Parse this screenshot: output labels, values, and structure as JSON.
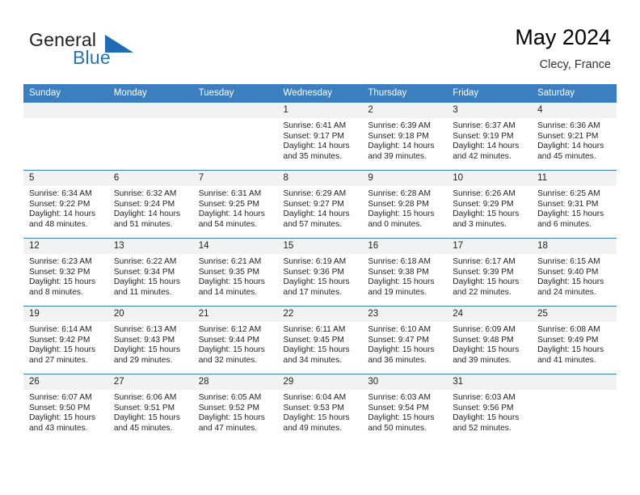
{
  "brand": {
    "name_part1": "General",
    "name_part2": "Blue",
    "triangle_color": "#1f6cb4"
  },
  "header": {
    "title": "May 2024",
    "subtitle": "Clecy, France"
  },
  "theme": {
    "header_blue": "#3c7fc1",
    "daynum_bg": "#f2f2f2",
    "text": "#231f20"
  },
  "weekday_headers": [
    "Sunday",
    "Monday",
    "Tuesday",
    "Wednesday",
    "Thursday",
    "Friday",
    "Saturday"
  ],
  "labels": {
    "sunrise_prefix": "Sunrise: ",
    "sunset_prefix": "Sunset: ",
    "daylight_prefix": "Daylight: "
  },
  "weeks": [
    [
      {
        "day": "",
        "empty": true
      },
      {
        "day": "",
        "empty": true
      },
      {
        "day": "",
        "empty": true
      },
      {
        "day": "1",
        "sunrise": "Sunrise: 6:41 AM",
        "sunset": "Sunset: 9:17 PM",
        "daylight_line1": "Daylight: 14 hours",
        "daylight_line2": "and 35 minutes."
      },
      {
        "day": "2",
        "sunrise": "Sunrise: 6:39 AM",
        "sunset": "Sunset: 9:18 PM",
        "daylight_line1": "Daylight: 14 hours",
        "daylight_line2": "and 39 minutes."
      },
      {
        "day": "3",
        "sunrise": "Sunrise: 6:37 AM",
        "sunset": "Sunset: 9:19 PM",
        "daylight_line1": "Daylight: 14 hours",
        "daylight_line2": "and 42 minutes."
      },
      {
        "day": "4",
        "sunrise": "Sunrise: 6:36 AM",
        "sunset": "Sunset: 9:21 PM",
        "daylight_line1": "Daylight: 14 hours",
        "daylight_line2": "and 45 minutes."
      }
    ],
    [
      {
        "day": "5",
        "sunrise": "Sunrise: 6:34 AM",
        "sunset": "Sunset: 9:22 PM",
        "daylight_line1": "Daylight: 14 hours",
        "daylight_line2": "and 48 minutes."
      },
      {
        "day": "6",
        "sunrise": "Sunrise: 6:32 AM",
        "sunset": "Sunset: 9:24 PM",
        "daylight_line1": "Daylight: 14 hours",
        "daylight_line2": "and 51 minutes."
      },
      {
        "day": "7",
        "sunrise": "Sunrise: 6:31 AM",
        "sunset": "Sunset: 9:25 PM",
        "daylight_line1": "Daylight: 14 hours",
        "daylight_line2": "and 54 minutes."
      },
      {
        "day": "8",
        "sunrise": "Sunrise: 6:29 AM",
        "sunset": "Sunset: 9:27 PM",
        "daylight_line1": "Daylight: 14 hours",
        "daylight_line2": "and 57 minutes."
      },
      {
        "day": "9",
        "sunrise": "Sunrise: 6:28 AM",
        "sunset": "Sunset: 9:28 PM",
        "daylight_line1": "Daylight: 15 hours",
        "daylight_line2": "and 0 minutes."
      },
      {
        "day": "10",
        "sunrise": "Sunrise: 6:26 AM",
        "sunset": "Sunset: 9:29 PM",
        "daylight_line1": "Daylight: 15 hours",
        "daylight_line2": "and 3 minutes."
      },
      {
        "day": "11",
        "sunrise": "Sunrise: 6:25 AM",
        "sunset": "Sunset: 9:31 PM",
        "daylight_line1": "Daylight: 15 hours",
        "daylight_line2": "and 6 minutes."
      }
    ],
    [
      {
        "day": "12",
        "sunrise": "Sunrise: 6:23 AM",
        "sunset": "Sunset: 9:32 PM",
        "daylight_line1": "Daylight: 15 hours",
        "daylight_line2": "and 8 minutes."
      },
      {
        "day": "13",
        "sunrise": "Sunrise: 6:22 AM",
        "sunset": "Sunset: 9:34 PM",
        "daylight_line1": "Daylight: 15 hours",
        "daylight_line2": "and 11 minutes."
      },
      {
        "day": "14",
        "sunrise": "Sunrise: 6:21 AM",
        "sunset": "Sunset: 9:35 PM",
        "daylight_line1": "Daylight: 15 hours",
        "daylight_line2": "and 14 minutes."
      },
      {
        "day": "15",
        "sunrise": "Sunrise: 6:19 AM",
        "sunset": "Sunset: 9:36 PM",
        "daylight_line1": "Daylight: 15 hours",
        "daylight_line2": "and 17 minutes."
      },
      {
        "day": "16",
        "sunrise": "Sunrise: 6:18 AM",
        "sunset": "Sunset: 9:38 PM",
        "daylight_line1": "Daylight: 15 hours",
        "daylight_line2": "and 19 minutes."
      },
      {
        "day": "17",
        "sunrise": "Sunrise: 6:17 AM",
        "sunset": "Sunset: 9:39 PM",
        "daylight_line1": "Daylight: 15 hours",
        "daylight_line2": "and 22 minutes."
      },
      {
        "day": "18",
        "sunrise": "Sunrise: 6:15 AM",
        "sunset": "Sunset: 9:40 PM",
        "daylight_line1": "Daylight: 15 hours",
        "daylight_line2": "and 24 minutes."
      }
    ],
    [
      {
        "day": "19",
        "sunrise": "Sunrise: 6:14 AM",
        "sunset": "Sunset: 9:42 PM",
        "daylight_line1": "Daylight: 15 hours",
        "daylight_line2": "and 27 minutes."
      },
      {
        "day": "20",
        "sunrise": "Sunrise: 6:13 AM",
        "sunset": "Sunset: 9:43 PM",
        "daylight_line1": "Daylight: 15 hours",
        "daylight_line2": "and 29 minutes."
      },
      {
        "day": "21",
        "sunrise": "Sunrise: 6:12 AM",
        "sunset": "Sunset: 9:44 PM",
        "daylight_line1": "Daylight: 15 hours",
        "daylight_line2": "and 32 minutes."
      },
      {
        "day": "22",
        "sunrise": "Sunrise: 6:11 AM",
        "sunset": "Sunset: 9:45 PM",
        "daylight_line1": "Daylight: 15 hours",
        "daylight_line2": "and 34 minutes."
      },
      {
        "day": "23",
        "sunrise": "Sunrise: 6:10 AM",
        "sunset": "Sunset: 9:47 PM",
        "daylight_line1": "Daylight: 15 hours",
        "daylight_line2": "and 36 minutes."
      },
      {
        "day": "24",
        "sunrise": "Sunrise: 6:09 AM",
        "sunset": "Sunset: 9:48 PM",
        "daylight_line1": "Daylight: 15 hours",
        "daylight_line2": "and 39 minutes."
      },
      {
        "day": "25",
        "sunrise": "Sunrise: 6:08 AM",
        "sunset": "Sunset: 9:49 PM",
        "daylight_line1": "Daylight: 15 hours",
        "daylight_line2": "and 41 minutes."
      }
    ],
    [
      {
        "day": "26",
        "sunrise": "Sunrise: 6:07 AM",
        "sunset": "Sunset: 9:50 PM",
        "daylight_line1": "Daylight: 15 hours",
        "daylight_line2": "and 43 minutes."
      },
      {
        "day": "27",
        "sunrise": "Sunrise: 6:06 AM",
        "sunset": "Sunset: 9:51 PM",
        "daylight_line1": "Daylight: 15 hours",
        "daylight_line2": "and 45 minutes."
      },
      {
        "day": "28",
        "sunrise": "Sunrise: 6:05 AM",
        "sunset": "Sunset: 9:52 PM",
        "daylight_line1": "Daylight: 15 hours",
        "daylight_line2": "and 47 minutes."
      },
      {
        "day": "29",
        "sunrise": "Sunrise: 6:04 AM",
        "sunset": "Sunset: 9:53 PM",
        "daylight_line1": "Daylight: 15 hours",
        "daylight_line2": "and 49 minutes."
      },
      {
        "day": "30",
        "sunrise": "Sunrise: 6:03 AM",
        "sunset": "Sunset: 9:54 PM",
        "daylight_line1": "Daylight: 15 hours",
        "daylight_line2": "and 50 minutes."
      },
      {
        "day": "31",
        "sunrise": "Sunrise: 6:03 AM",
        "sunset": "Sunset: 9:56 PM",
        "daylight_line1": "Daylight: 15 hours",
        "daylight_line2": "and 52 minutes."
      },
      {
        "day": "",
        "empty": true
      }
    ]
  ]
}
